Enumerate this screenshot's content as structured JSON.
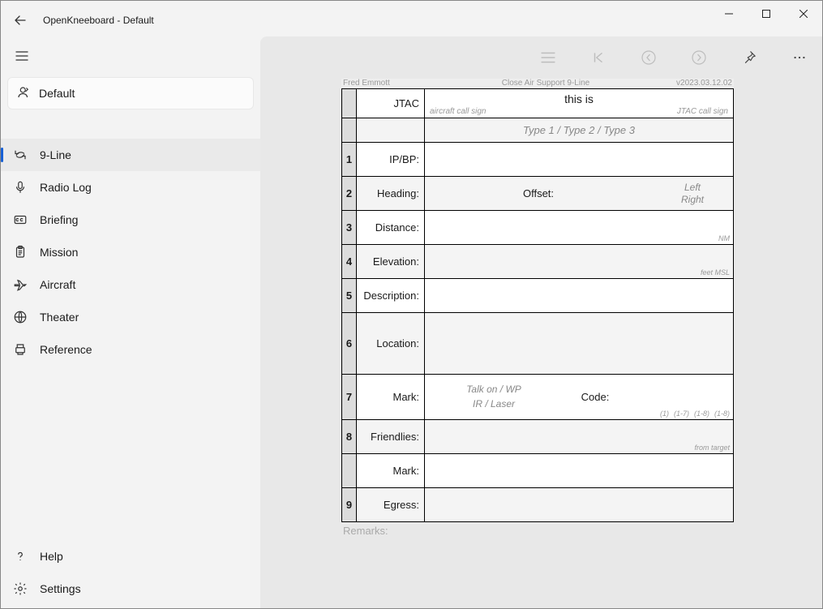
{
  "window": {
    "title": "OpenKneeboard - Default"
  },
  "sidebar": {
    "tab_label": "Default",
    "items": [
      {
        "label": "9-Line",
        "selected": true
      },
      {
        "label": "Radio Log",
        "selected": false
      },
      {
        "label": "Briefing",
        "selected": false
      },
      {
        "label": "Mission",
        "selected": false
      },
      {
        "label": "Aircraft",
        "selected": false
      },
      {
        "label": "Theater",
        "selected": false
      },
      {
        "label": "Reference",
        "selected": false
      }
    ],
    "bottom": [
      {
        "label": "Help"
      },
      {
        "label": "Settings"
      }
    ]
  },
  "doc": {
    "header": {
      "author": "Fred Emmott",
      "title": "Close Air Support 9-Line",
      "version": "v2023.03.12.02"
    },
    "jtac": {
      "label": "JTAC",
      "value": "this is",
      "hint_aircraft": "aircraft call sign",
      "hint_jtac": "JTAC call sign"
    },
    "type_line": "Type  1  /  Type 2  /  Type 3",
    "rows": {
      "r1": {
        "n": "1",
        "label": "IP/BP:"
      },
      "r2": {
        "n": "2",
        "label": "Heading:",
        "offset_label": "Offset:",
        "opt_left": "Left",
        "opt_right": "Right"
      },
      "r3": {
        "n": "3",
        "label": "Distance:",
        "hint": "NM"
      },
      "r4": {
        "n": "4",
        "label": "Elevation:",
        "hint": "feet MSL"
      },
      "r5": {
        "n": "5",
        "label": "Description:"
      },
      "r6": {
        "n": "6",
        "label": "Location:"
      },
      "r7": {
        "n": "7",
        "label": "Mark:",
        "mark_line1": "Talk on  /  WP",
        "mark_line2": "IR /  Laser",
        "code_label": "Code:",
        "code_h1": "(1)",
        "code_h2": "(1-7)",
        "code_h3": "(1-8)",
        "code_h4": "(1-8)"
      },
      "r8": {
        "n": "8",
        "label": "Friendlies:",
        "hint": "from target"
      },
      "r8b": {
        "label": "Mark:"
      },
      "r9": {
        "n": "9",
        "label": "Egress:"
      }
    },
    "remarks_label": "Remarks:"
  }
}
